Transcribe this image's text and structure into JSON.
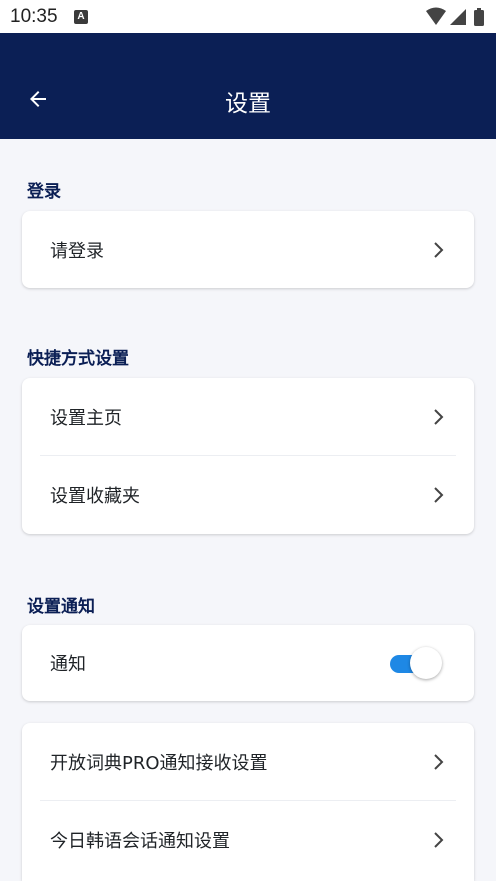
{
  "status_bar": {
    "time": "10:35",
    "notification_icon": "a-letter-icon"
  },
  "app_bar": {
    "title": "设置",
    "back_icon": "arrow-left-icon"
  },
  "sections": {
    "login": {
      "title": "登录",
      "items": [
        {
          "label": "请登录"
        }
      ]
    },
    "shortcuts": {
      "title": "快捷方式设置",
      "items": [
        {
          "label": "设置主页"
        },
        {
          "label": "设置收藏夹"
        }
      ]
    },
    "notifications": {
      "title": "设置通知",
      "toggle_item": {
        "label": "通知",
        "enabled": true
      },
      "items": [
        {
          "label": "开放词典PRO通知接收设置"
        },
        {
          "label": "今日韩语会话通知设置"
        }
      ]
    }
  },
  "colors": {
    "app_bar": "#0b1f55",
    "section_title": "#0b1f55",
    "toggle_on": "#1e88e5",
    "background": "#f5f6fa"
  }
}
